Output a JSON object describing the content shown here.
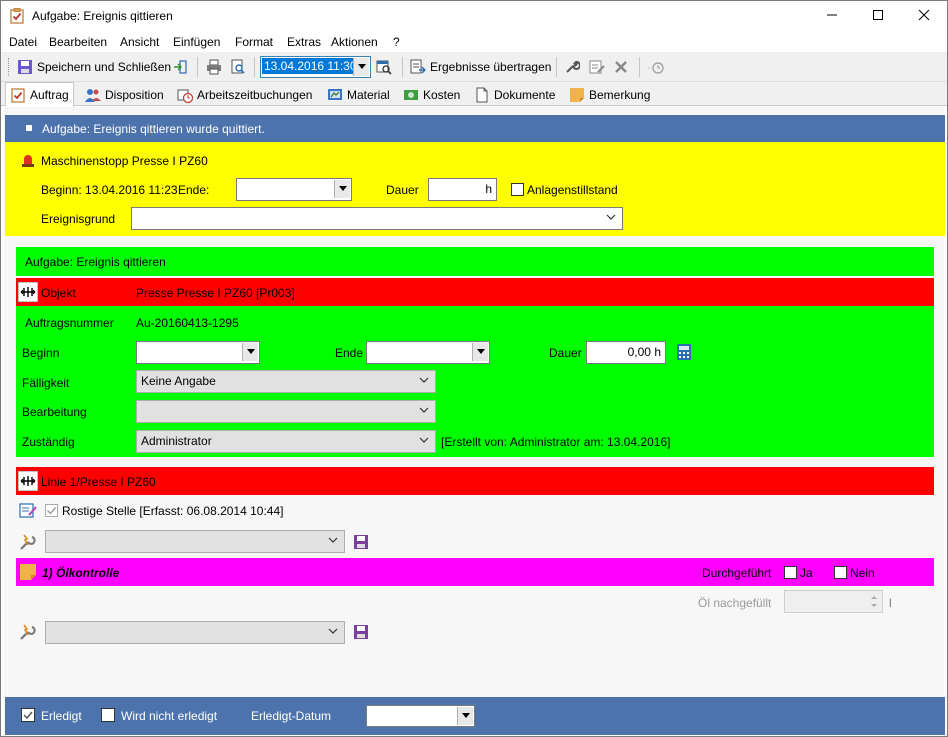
{
  "window": {
    "title": "Aufgabe: Ereignis qittieren"
  },
  "menu": [
    "Datei",
    "Bearbeiten",
    "Ansicht",
    "Einfügen",
    "Format",
    "Extras",
    "Aktionen",
    "?"
  ],
  "toolbar": {
    "save_close": "Speichern und Schließen",
    "date_value": "13.04.2016 11:30",
    "transfer_results": "Ergebnisse übertragen"
  },
  "tabs": [
    "Auftrag",
    "Disposition",
    "Arbeitszeitbuchungen",
    "Material",
    "Kosten",
    "Dokumente",
    "Bemerkung"
  ],
  "status_bar": {
    "text": "Aufgabe: Ereignis qittieren wurde quittiert."
  },
  "event": {
    "title": "Maschinenstopp Presse I PZ60",
    "begin": "Beginn: 13.04.2016 11:23",
    "end_label": "Ende:",
    "end_value": "",
    "duration_label": "Dauer",
    "duration_value": "h",
    "downtime_label": "Anlagenstillstand",
    "reason_label": "Ereignisgrund",
    "reason_value": ""
  },
  "task": {
    "header": "Aufgabe: Ereignis qittieren",
    "object_label": "Objekt",
    "object_value": "Presse Presse I PZ60 [Pr003]",
    "order_label": "Auftragsnummer",
    "order_value": "Au-20160413-1295",
    "begin_label": "Beginn",
    "end_label": "Ende",
    "duration_label": "Dauer",
    "duration_value": "0,00 h",
    "due_label": "Fälligkeit",
    "due_value": "Keine Angabe",
    "processing_label": "Bearbeitung",
    "processing_value": "",
    "responsible_label": "Zuständig",
    "responsible_value": "Administrator",
    "created_info": "[Erstellt von: Administrator am: 13.04.2016]"
  },
  "line": {
    "header": "Linie 1/Presse I PZ60",
    "finding": "Rostige Stelle [Erfasst: 06.08.2014 10:44]",
    "action_value": ""
  },
  "check": {
    "title": "1) Ölkontrolle",
    "done_label": "Durchgeführt",
    "yes_label": "Ja",
    "no_label": "Nein",
    "oil_label": "Öl nachgefüllt",
    "oil_unit": "l",
    "action_value": ""
  },
  "footer": {
    "done_label": "Erledigt",
    "not_done_label": "Wird nicht erledigt",
    "date_label": "Erledigt-Datum",
    "date_value": ""
  },
  "colors": {
    "blue": "#4d73ad",
    "yellow": "#ffff00",
    "green": "#00ff00",
    "red": "#ff0000",
    "magenta": "#ff00ff"
  }
}
